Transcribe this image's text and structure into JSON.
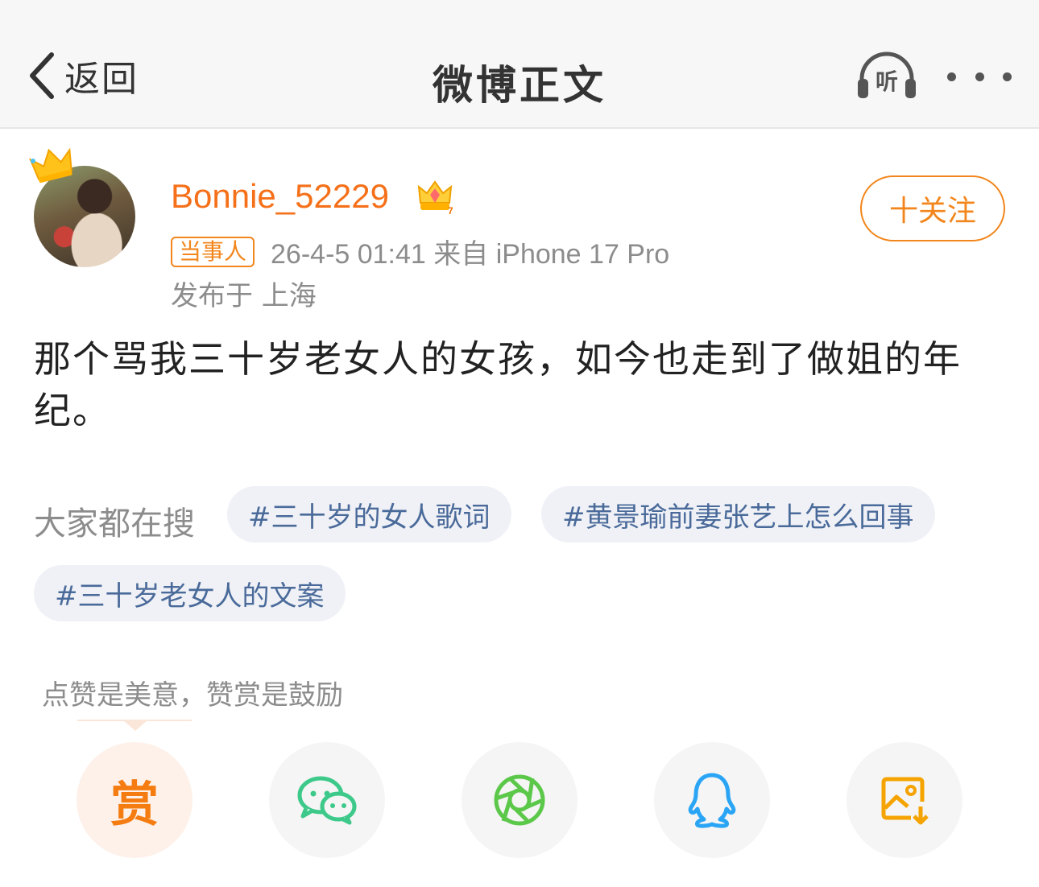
{
  "header": {
    "back_label": "返回",
    "title": "微博正文",
    "listen_label": "听"
  },
  "author": {
    "name": "Bonnie_52229",
    "tag": "当事人",
    "meta": "26-4-5 01:41  来自 iPhone 17 Pro",
    "location": "发布于 上海",
    "follow_label": "十关注"
  },
  "post": {
    "text": "那个骂我三十岁老女人的女孩，如今也走到了做姐的年纪。"
  },
  "hot_search": {
    "label": "大家都在搜",
    "chips": [
      "#三十岁的女人歌词",
      "#黄景瑜前妻张艺上怎么回事",
      "#三十岁老女人的文案"
    ]
  },
  "reward": {
    "hint": "点赞是美意，赞赏是鼓励",
    "button_label": "赏"
  },
  "share_icons": [
    "reward-icon",
    "wechat-icon",
    "moments-icon",
    "qq-icon",
    "save-image-icon"
  ],
  "colors": {
    "accent": "#f57019",
    "chip_text": "#4a6a9a",
    "chip_bg": "#eff1f6"
  }
}
